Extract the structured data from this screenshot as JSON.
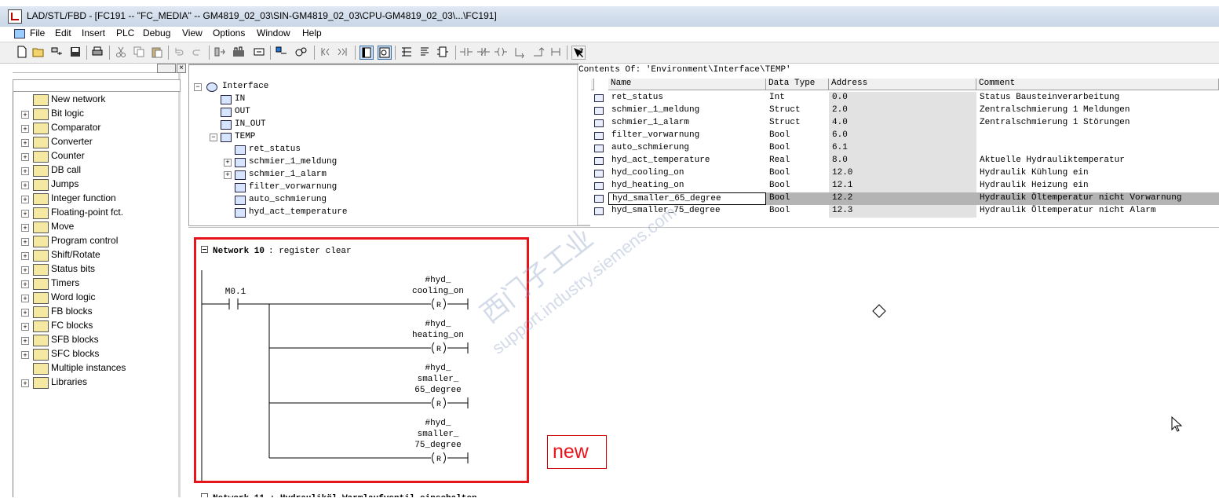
{
  "window": {
    "title": "LAD/STL/FBD  - [FC191 -- \"FC_MEDIA\" -- GM4819_02_03\\SIN-GM4819_02_03\\CPU-GM4819_02_03\\...\\FC191]"
  },
  "menu": [
    "File",
    "Edit",
    "Insert",
    "PLC",
    "Debug",
    "View",
    "Options",
    "Window",
    "Help"
  ],
  "toolbar": {
    "icons": [
      "new-icon",
      "open-icon",
      "accessible-nodes-icon",
      "save-icon",
      "print-icon",
      "cut-icon",
      "copy-icon",
      "paste-icon",
      "undo-icon",
      "redo-icon",
      "load-icon",
      "monitor-icon",
      "module-info-icon",
      "monitor-on-off-icon",
      "overview-icon",
      "details-icon",
      "network-nav-icon",
      "toggle-icon",
      "contact-no-icon",
      "contact-nc-icon",
      "coil-icon",
      "branch-open-icon",
      "branch-close-icon",
      "help-icon"
    ]
  },
  "program_elements": {
    "items": [
      {
        "label": "New network",
        "icon": "network-icon",
        "expandable": false
      },
      {
        "label": "Bit logic",
        "icon": "bit-logic-icon",
        "expandable": true
      },
      {
        "label": "Comparator",
        "icon": "comparator-icon",
        "expandable": true
      },
      {
        "label": "Converter",
        "icon": "converter-icon",
        "expandable": true
      },
      {
        "label": "Counter",
        "icon": "counter-icon",
        "expandable": true
      },
      {
        "label": "DB call",
        "icon": "db-call-icon",
        "expandable": true
      },
      {
        "label": "Jumps",
        "icon": "jumps-icon",
        "expandable": true
      },
      {
        "label": "Integer function",
        "icon": "integer-icon",
        "expandable": true
      },
      {
        "label": "Floating-point fct.",
        "icon": "floating-point-icon",
        "expandable": true
      },
      {
        "label": "Move",
        "icon": "move-icon",
        "expandable": true
      },
      {
        "label": "Program control",
        "icon": "program-control-icon",
        "expandable": true
      },
      {
        "label": "Shift/Rotate",
        "icon": "shift-rotate-icon",
        "expandable": true
      },
      {
        "label": "Status bits",
        "icon": "status-bits-icon",
        "expandable": true
      },
      {
        "label": "Timers",
        "icon": "timers-icon",
        "expandable": true
      },
      {
        "label": "Word logic",
        "icon": "word-logic-icon",
        "expandable": true
      },
      {
        "label": "FB blocks",
        "icon": "fb-blocks-icon",
        "expandable": true
      },
      {
        "label": "FC blocks",
        "icon": "fc-blocks-icon",
        "expandable": true
      },
      {
        "label": "SFB blocks",
        "icon": "sfb-blocks-icon",
        "expandable": true
      },
      {
        "label": "SFC blocks",
        "icon": "sfc-blocks-icon",
        "expandable": true
      },
      {
        "label": "Multiple instances",
        "icon": "multiple-instances-icon",
        "expandable": false
      },
      {
        "label": "Libraries",
        "icon": "libraries-icon",
        "expandable": true
      }
    ]
  },
  "interface_tree": {
    "root": "Interface",
    "items": [
      {
        "label": "IN",
        "level": 1,
        "expander": "none"
      },
      {
        "label": "OUT",
        "level": 1,
        "expander": "none"
      },
      {
        "label": "IN_OUT",
        "level": 1,
        "expander": "none"
      },
      {
        "label": "TEMP",
        "level": 1,
        "expander": "minus"
      },
      {
        "label": "ret_status",
        "level": 2,
        "expander": "none"
      },
      {
        "label": "schmier_1_meldung",
        "level": 2,
        "expander": "plus"
      },
      {
        "label": "schmier_1_alarm",
        "level": 2,
        "expander": "plus"
      },
      {
        "label": "filter_vorwarnung",
        "level": 2,
        "expander": "none"
      },
      {
        "label": "auto_schmierung",
        "level": 2,
        "expander": "none"
      },
      {
        "label": "hyd_act_temperature",
        "level": 2,
        "expander": "none"
      }
    ]
  },
  "contents": {
    "caption": "Contents Of: 'Environment\\Interface\\TEMP'",
    "columns": [
      "Name",
      "Data Type",
      "Address",
      "Comment"
    ],
    "rows": [
      {
        "name": "ret_status",
        "type": "Int",
        "address": "0.0",
        "comment": "Status Bausteinverarbeitung"
      },
      {
        "name": "schmier_1_meldung",
        "type": "Struct",
        "address": "2.0",
        "comment": "Zentralschmierung 1 Meldungen"
      },
      {
        "name": "schmier_1_alarm",
        "type": "Struct",
        "address": "4.0",
        "comment": "Zentralschmierung 1 Störungen"
      },
      {
        "name": "filter_vorwarnung",
        "type": "Bool",
        "address": "6.0",
        "comment": ""
      },
      {
        "name": "auto_schmierung",
        "type": "Bool",
        "address": "6.1",
        "comment": ""
      },
      {
        "name": "hyd_act_temperature",
        "type": "Real",
        "address": "8.0",
        "comment": "Aktuelle Hydrauliktemperatur"
      },
      {
        "name": "hyd_cooling_on",
        "type": "Bool",
        "address": "12.0",
        "comment": "Hydraulik Kühlung ein"
      },
      {
        "name": "hyd_heating_on",
        "type": "Bool",
        "address": "12.1",
        "comment": "Hydraulik Heizung ein"
      },
      {
        "name": "hyd_smaller_65_degree",
        "type": "Bool",
        "address": "12.2",
        "comment": "Hydraulik Öltemperatur nicht Vorwarnung",
        "selected": true
      },
      {
        "name": "hyd_smaller_75_degree",
        "type": "Bool",
        "address": "12.3",
        "comment": "Hydraulik Öltemperatur nicht Alarm"
      }
    ]
  },
  "network": {
    "title": "Network 10",
    "comment": ": register clear",
    "contact": "M0.1",
    "coils": [
      {
        "lines": [
          "#hyd_",
          "cooling_on"
        ],
        "op": "R"
      },
      {
        "lines": [
          "#hyd_",
          "heating_on"
        ],
        "op": "R"
      },
      {
        "lines": [
          "#hyd_",
          "smaller_",
          "65_degree"
        ],
        "op": "R"
      },
      {
        "lines": [
          "#hyd_",
          "smaller_",
          "75_degree"
        ],
        "op": "R"
      }
    ],
    "next_network": "Network 11 : Hydrauliköl Warmlaufventil einschalten"
  },
  "annotation": {
    "label": "new",
    "color": "#e8141b"
  },
  "watermark": {
    "line1": "西门子工业",
    "line2": "support.industry.siemens.com"
  }
}
